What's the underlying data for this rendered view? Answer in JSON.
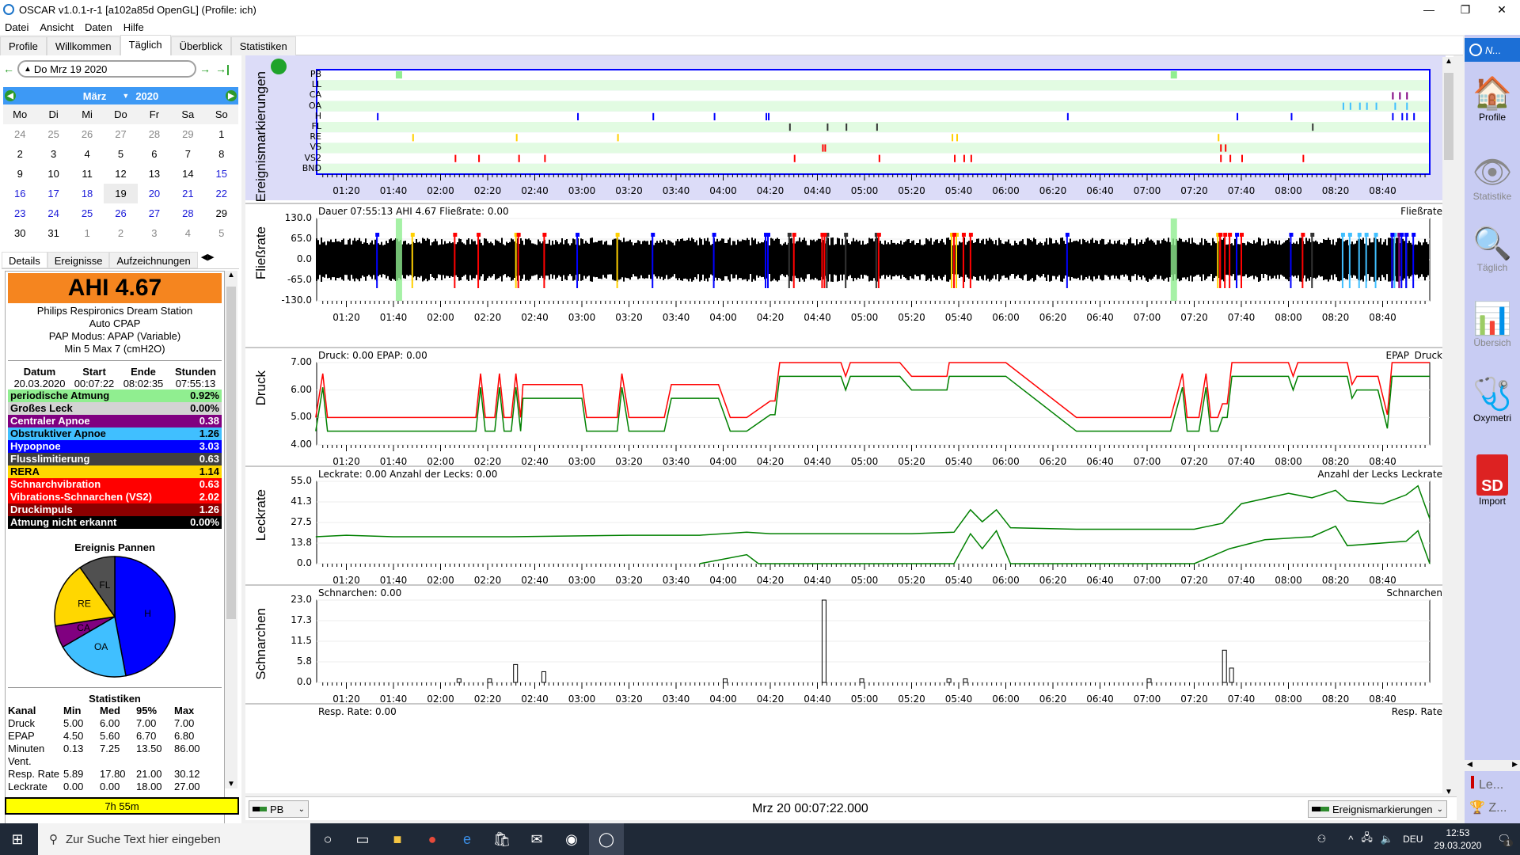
{
  "window": {
    "title": "OSCAR v1.0.1-r-1 [a102a85d OpenGL] (Profile: ich)",
    "minimize": "—",
    "maximize": "❐",
    "close": "✕"
  },
  "menu": [
    "Datei",
    "Ansicht",
    "Daten",
    "Hilfe"
  ],
  "tabs": [
    {
      "label": "Profile"
    },
    {
      "label": "Willkommen"
    },
    {
      "label": "Täglich",
      "active": true
    },
    {
      "label": "Überblick"
    },
    {
      "label": "Statistiken"
    }
  ],
  "datenav": {
    "prev": "←",
    "date": "Do Mrz 19 2020",
    "next": "→",
    "last": "→|"
  },
  "calendar": {
    "month": "März",
    "year": "2020",
    "dow": [
      "Mo",
      "Di",
      "Mi",
      "Do",
      "Fr",
      "Sa",
      "So"
    ],
    "weeks": [
      [
        {
          "d": "24",
          "c": "other"
        },
        {
          "d": "25",
          "c": "other"
        },
        {
          "d": "26",
          "c": "other"
        },
        {
          "d": "27",
          "c": "other"
        },
        {
          "d": "28",
          "c": "other"
        },
        {
          "d": "29",
          "c": "other"
        },
        {
          "d": "1",
          "c": ""
        }
      ],
      [
        {
          "d": "2",
          "c": ""
        },
        {
          "d": "3",
          "c": ""
        },
        {
          "d": "4",
          "c": ""
        },
        {
          "d": "5",
          "c": ""
        },
        {
          "d": "6",
          "c": ""
        },
        {
          "d": "7",
          "c": ""
        },
        {
          "d": "8",
          "c": ""
        }
      ],
      [
        {
          "d": "9",
          "c": ""
        },
        {
          "d": "10",
          "c": ""
        },
        {
          "d": "11",
          "c": ""
        },
        {
          "d": "12",
          "c": ""
        },
        {
          "d": "13",
          "c": ""
        },
        {
          "d": "14",
          "c": ""
        },
        {
          "d": "15",
          "c": "we"
        }
      ],
      [
        {
          "d": "16",
          "c": "we"
        },
        {
          "d": "17",
          "c": "we"
        },
        {
          "d": "18",
          "c": "we"
        },
        {
          "d": "19",
          "c": "sel"
        },
        {
          "d": "20",
          "c": "we"
        },
        {
          "d": "21",
          "c": "we"
        },
        {
          "d": "22",
          "c": "we"
        }
      ],
      [
        {
          "d": "23",
          "c": "we"
        },
        {
          "d": "24",
          "c": "we"
        },
        {
          "d": "25",
          "c": "we"
        },
        {
          "d": "26",
          "c": "we"
        },
        {
          "d": "27",
          "c": "we"
        },
        {
          "d": "28",
          "c": "we"
        },
        {
          "d": "29",
          "c": ""
        }
      ],
      [
        {
          "d": "30",
          "c": ""
        },
        {
          "d": "31",
          "c": ""
        },
        {
          "d": "1",
          "c": "other"
        },
        {
          "d": "2",
          "c": "other"
        },
        {
          "d": "3",
          "c": "other"
        },
        {
          "d": "4",
          "c": "other"
        },
        {
          "d": "5",
          "c": "other"
        }
      ]
    ]
  },
  "subtabs": [
    "Details",
    "Ereignisse",
    "Aufzeichnungen"
  ],
  "details": {
    "ahi": "AHI 4.67",
    "ahi_color": "#f5851f",
    "device": [
      "Philips Respironics Dream Station",
      "Auto CPAP",
      "PAP Modus: APAP (Variable)",
      "Min 5 Max 7 (cmH2O)"
    ],
    "session_headers": [
      "Datum",
      "Start",
      "Ende",
      "Stunden"
    ],
    "session": [
      "20.03.2020",
      "00:07:22",
      "08:02:35",
      "07:55:13"
    ],
    "events": [
      {
        "label": "periodische Atmung",
        "value": "0.92%",
        "bg": "#90ee90",
        "fg": "#000"
      },
      {
        "label": "Großes Leck",
        "value": "0.00%",
        "bg": "#d3d3d3",
        "fg": "#000"
      },
      {
        "label": "Centraler Apnoe",
        "value": "0.38",
        "bg": "#800080",
        "fg": "#fff"
      },
      {
        "label": "Obstruktiver Apnoe",
        "value": "1.26",
        "bg": "#40bfff",
        "fg": "#000"
      },
      {
        "label": "Hypopnoe",
        "value": "3.03",
        "bg": "#0000ff",
        "fg": "#fff"
      },
      {
        "label": "Flusslimitierung",
        "value": "0.63",
        "bg": "#404040",
        "fg": "#fff"
      },
      {
        "label": "RERA",
        "value": "1.14",
        "bg": "#ffd700",
        "fg": "#000"
      },
      {
        "label": "Schnarchvibration",
        "value": "0.63",
        "bg": "#ff0000",
        "fg": "#fff"
      },
      {
        "label": "Vibrations-Schnarchen (VS2)",
        "value": "2.02",
        "bg": "#ff0000",
        "fg": "#fff"
      },
      {
        "label": "Druckimpuls",
        "value": "1.26",
        "bg": "#8b0000",
        "fg": "#fff"
      },
      {
        "label": "Atmung nicht erkannt",
        "value": "0.00%",
        "bg": "#000000",
        "fg": "#fff"
      }
    ],
    "pie": {
      "title": "Ereignis Pannen",
      "slices": [
        {
          "label": "H",
          "value": 3.03,
          "color": "#0000ff"
        },
        {
          "label": "OA",
          "value": 1.26,
          "color": "#40bfff"
        },
        {
          "label": "CA",
          "value": 0.38,
          "color": "#800080"
        },
        {
          "label": "RE",
          "value": 1.14,
          "color": "#ffd700"
        },
        {
          "label": "FL",
          "value": 0.63,
          "color": "#505050"
        }
      ]
    },
    "stats": {
      "title": "Statistiken",
      "headers": [
        "Kanal",
        "Min",
        "Med",
        "95%",
        "Max"
      ],
      "rows": [
        [
          "Druck",
          "5.00",
          "6.00",
          "7.00",
          "7.00"
        ],
        [
          "EPAP",
          "4.50",
          "5.60",
          "6.70",
          "6.80"
        ],
        [
          "Minuten",
          "0.13",
          "7.25",
          "13.50",
          "86.00"
        ],
        [
          "Vent.",
          "",
          "",
          "",
          ""
        ],
        [
          "Resp. Rate",
          "5.89",
          "17.80",
          "21.00",
          "30.12"
        ],
        [
          "Leckrate",
          "0.00",
          "0.00",
          "18.00",
          "27.00"
        ]
      ]
    },
    "duration_bar": "7h 55m"
  },
  "graphs": {
    "x_ticks": [
      "01:20",
      "01:40",
      "02:00",
      "02:20",
      "02:40",
      "03:00",
      "03:20",
      "03:40",
      "04:00",
      "04:20",
      "04:40",
      "05:00",
      "05:20",
      "05:40",
      "06:00",
      "06:20",
      "06:40",
      "07:00",
      "07:20",
      "07:40",
      "08:00",
      "08:20",
      "08:40"
    ],
    "events": {
      "ylabel": "Ereignismarkierungen",
      "channels": [
        "PB",
        "LL",
        "CA",
        "OA",
        "H",
        "FL",
        "RE",
        "VS",
        "VS2",
        "BND"
      ]
    },
    "flow": {
      "ylabel": "Fließrate",
      "title": "Dauer 07:55:13 AHI 4.67 Fließrate: 0.00",
      "legend": "Fließrate",
      "yticks": [
        "130.0",
        "65.0",
        "0.0",
        "-65.0",
        "-130.0"
      ]
    },
    "pressure": {
      "ylabel": "Druck",
      "title": "Druck: 0.00 EPAP: 0.00",
      "legend": [
        "EPAP",
        "Druck"
      ],
      "yticks": [
        "7.00",
        "6.00",
        "5.00",
        "4.00"
      ]
    },
    "leak": {
      "ylabel": "Leckrate",
      "title": "Leckrate: 0.00 Anzahl der Lecks: 0.00",
      "legend": [
        "Anzahl der Lecks",
        "Leckrate"
      ],
      "yticks": [
        "55.0",
        "41.3",
        "27.5",
        "13.8",
        "0.0"
      ]
    },
    "snore": {
      "ylabel": "Schnarchen",
      "title": "Schnarchen: 0.00",
      "legend": "Schnarchen",
      "yticks": [
        "23.0",
        "17.3",
        "11.5",
        "5.8",
        "0.0"
      ]
    },
    "resp": {
      "title": "Resp. Rate: 0.00",
      "legend": "Resp. Rate"
    }
  },
  "bottombar": {
    "channel_select": "PB",
    "position": "Mrz 20 00:07:22.000",
    "layers_select": "Ereignismarkierungen"
  },
  "sidebar": {
    "header": "N...",
    "items": [
      "Profile",
      "Statistike",
      "Täglich",
      "Übersich",
      "Oxymetri",
      "Import"
    ],
    "bottom": [
      "Le...",
      "Z..."
    ]
  },
  "taskbar": {
    "search_placeholder": "Zur Suche Text hier eingeben",
    "lang": "DEU",
    "time": "12:53",
    "date": "29.03.2020",
    "notif": "1"
  }
}
